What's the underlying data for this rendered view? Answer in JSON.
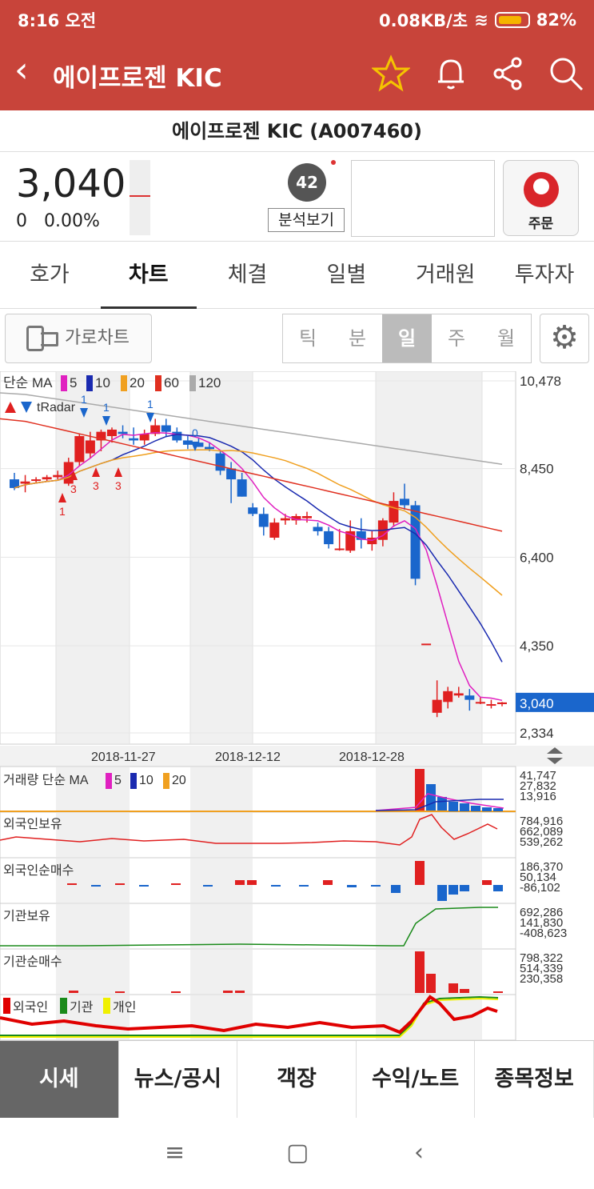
{
  "status": {
    "time": "8:16 오전",
    "network": "0.08KB/초",
    "battery": "82%"
  },
  "header": {
    "title": "에이프로젠 KIC"
  },
  "subtitle": "에이프로젠 KIC (A007460)",
  "quote": {
    "price": "3,040",
    "change": "0",
    "change_pct": "0.00%",
    "score": "42",
    "analyze_label": "분석보기",
    "order_label": "주문"
  },
  "tabs": [
    "호가",
    "차트",
    "체결",
    "일별",
    "거래원",
    "투자자"
  ],
  "toolbar": {
    "landscape_label": "가로차트",
    "periods": [
      "틱",
      "분",
      "일",
      "주",
      "월"
    ],
    "selected_period": "일"
  },
  "chart_data": {
    "type": "candlestick",
    "ma_legend_label": "단순 MA",
    "ma_periods": [
      "5",
      "10",
      "20",
      "60",
      "120"
    ],
    "ma_colors": [
      "#e020c0",
      "#1a2ab0",
      "#f0a020",
      "#e03020",
      "#aaaaaa"
    ],
    "radar_label": "tRadar",
    "y_ticks": [
      "10,478",
      "8,450",
      "6,400",
      "4,350",
      "2,334"
    ],
    "current_price": "3,040",
    "x_ticks": [
      "2018-11-27",
      "2018-12-12",
      "2018-12-28"
    ],
    "signals": {
      "up": [
        "1",
        "3",
        "3",
        "3"
      ],
      "down": [
        "1",
        "1",
        "1",
        "1",
        "0"
      ]
    },
    "candles": [
      [
        8200,
        8350,
        7950,
        8000
      ],
      [
        8100,
        8300,
        7900,
        8150
      ],
      [
        8200,
        8250,
        8100,
        8200
      ],
      [
        8200,
        8300,
        8150,
        8250
      ],
      [
        8250,
        8400,
        8200,
        8300
      ],
      [
        8100,
        8700,
        8050,
        8600
      ],
      [
        8600,
        9250,
        8500,
        9200
      ],
      [
        8800,
        9300,
        8700,
        9100
      ],
      [
        9100,
        9350,
        8850,
        9300
      ],
      [
        9200,
        9400,
        9050,
        9350
      ],
      [
        9300,
        9450,
        9150,
        9250
      ],
      [
        9150,
        9400,
        9000,
        9100
      ],
      [
        9100,
        9350,
        9000,
        9250
      ],
      [
        9250,
        9600,
        9200,
        9450
      ],
      [
        9450,
        9600,
        9200,
        9300
      ],
      [
        9300,
        9400,
        9050,
        9100
      ],
      [
        9100,
        9200,
        8900,
        9000
      ],
      [
        9050,
        9150,
        8950,
        8950
      ],
      [
        8950,
        9050,
        8850,
        8900
      ],
      [
        8800,
        8850,
        8300,
        8400
      ],
      [
        8450,
        8600,
        7650,
        8200
      ],
      [
        8200,
        8350,
        7800,
        7800
      ],
      [
        7550,
        7650,
        7350,
        7400
      ],
      [
        7400,
        7550,
        6900,
        7100
      ],
      [
        6850,
        7300,
        6800,
        7200
      ],
      [
        7250,
        7400,
        7150,
        7300
      ],
      [
        7250,
        7400,
        7150,
        7350
      ],
      [
        7300,
        7450,
        7200,
        7350
      ],
      [
        7100,
        7200,
        6900,
        7000
      ],
      [
        7000,
        7100,
        6600,
        6700
      ],
      [
        6600,
        7050,
        6550,
        6600
      ],
      [
        6550,
        7250,
        6500,
        7000
      ],
      [
        7000,
        7300,
        6600,
        6800
      ],
      [
        6700,
        7000,
        6550,
        6850
      ],
      [
        6800,
        7300,
        6650,
        7250
      ],
      [
        7200,
        7900,
        7100,
        7700
      ],
      [
        7750,
        8100,
        7500,
        7600
      ],
      [
        7600,
        7700,
        5750,
        5900
      ],
      [
        4400,
        4400,
        4400,
        4400
      ],
      [
        2800,
        3550,
        2700,
        3100
      ],
      [
        3050,
        3400,
        2900,
        3300
      ],
      [
        3200,
        3400,
        3150,
        3250
      ],
      [
        3200,
        3350,
        2850,
        3100
      ],
      [
        3050,
        3150,
        3000,
        3050
      ],
      [
        3000,
        3100,
        2900,
        3000
      ],
      [
        3000,
        3050,
        2950,
        3040
      ]
    ],
    "volume": {
      "label": "거래량 단순 MA",
      "ma": [
        "5",
        "10",
        "20"
      ],
      "ticks": [
        "41,747",
        "27,832",
        "13,916"
      ]
    },
    "foreign_hold": {
      "label": "외국인보유",
      "ticks": [
        "784,916",
        "662,089",
        "539,262"
      ]
    },
    "foreign_net": {
      "label": "외국인순매수",
      "ticks": [
        "186,370",
        "50,134",
        "-86,102"
      ]
    },
    "inst_hold": {
      "label": "기관보유",
      "ticks": [
        "692,286",
        "141,830",
        "-408,623"
      ]
    },
    "inst_net": {
      "label": "기관순매수",
      "ticks": [
        "798,322",
        "514,339",
        "230,358"
      ]
    },
    "investor": {
      "labels": [
        "외국인",
        "기관",
        "개인"
      ],
      "colors": [
        "#e00000",
        "#1a8a1a",
        "#f0f000"
      ]
    }
  },
  "bottom_nav": [
    "시세",
    "뉴스/공시",
    "객장",
    "수익/노트",
    "종목정보"
  ]
}
